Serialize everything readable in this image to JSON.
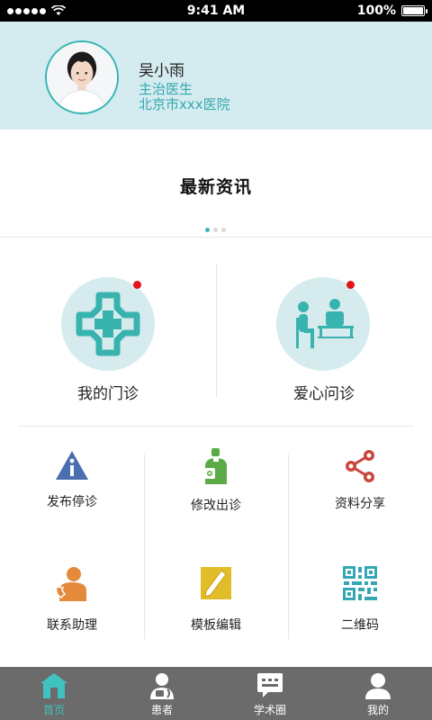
{
  "status_bar": {
    "time": "9:41 AM",
    "battery": "100%"
  },
  "profile": {
    "name": "吴小雨",
    "title": "主治医生",
    "hospital": "北京市xxx医院"
  },
  "news": {
    "title": "最新资讯",
    "page_count": 3,
    "active_page": 1
  },
  "features": [
    {
      "label": "我的门诊",
      "icon": "hospital-cross-icon",
      "has_notification": true
    },
    {
      "label": "爱心问诊",
      "icon": "consultation-icon",
      "has_notification": true
    }
  ],
  "grid": [
    {
      "label": "发布停诊",
      "icon": "info-warning-icon",
      "color": "#4a6fb0"
    },
    {
      "label": "修改出诊",
      "icon": "doctor-edit-icon",
      "color": "#5aab48"
    },
    {
      "label": "资料分享",
      "icon": "share-icon",
      "color": "#c9463d"
    },
    {
      "label": "联系助理",
      "icon": "assistant-phone-icon",
      "color": "#e58a3b"
    },
    {
      "label": "模板编辑",
      "icon": "template-pen-icon",
      "color": "#e2bd2a"
    },
    {
      "label": "二维码",
      "icon": "qr-code-icon",
      "color": "#36a6b5"
    }
  ],
  "tabs": [
    {
      "label": "首页",
      "icon": "home-icon",
      "active": true
    },
    {
      "label": "患者",
      "icon": "patient-icon",
      "active": false
    },
    {
      "label": "学术圈",
      "icon": "chat-icon",
      "active": false
    },
    {
      "label": "我的",
      "icon": "profile-icon",
      "active": false
    }
  ],
  "colors": {
    "accent": "#35b5b3",
    "header_bg": "#d4ebef",
    "tab_bg": "#6b6b6b",
    "notification": "#e3141b"
  }
}
